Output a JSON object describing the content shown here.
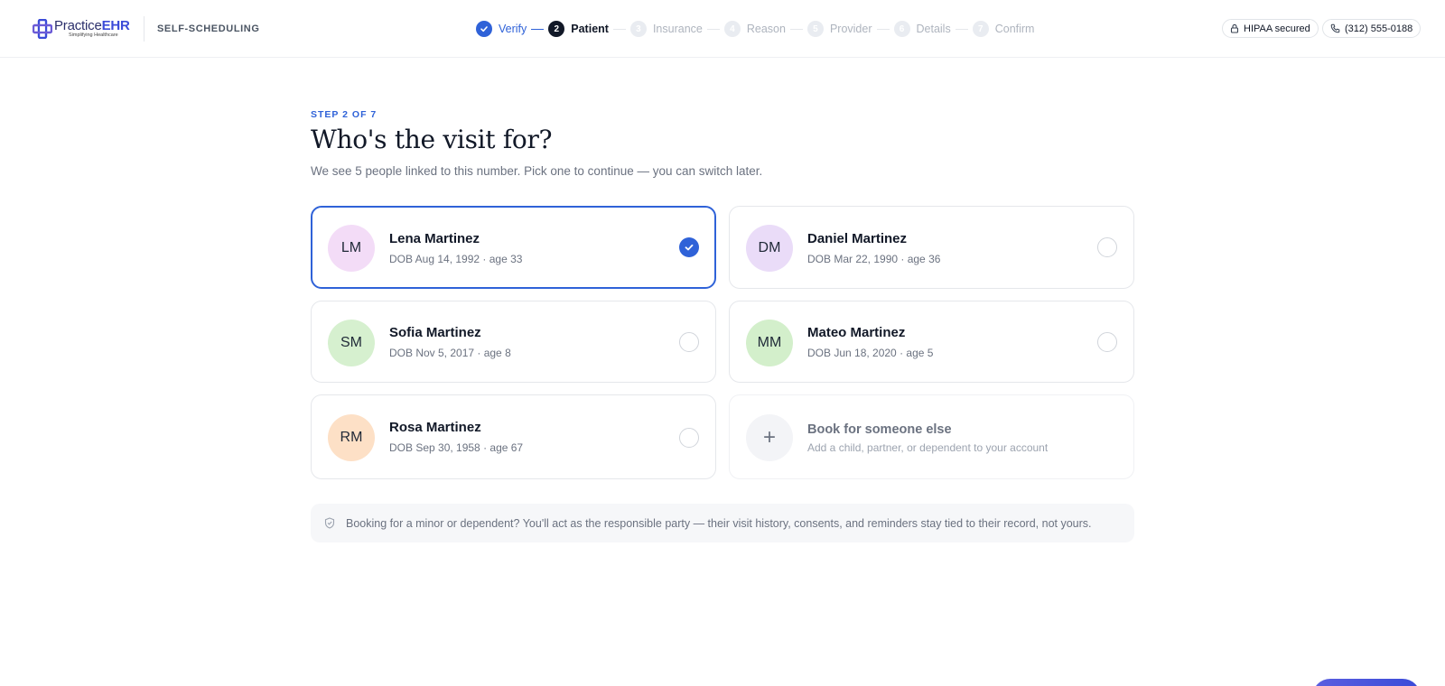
{
  "header": {
    "logo_text_a": "Practice",
    "logo_text_b": "EHR",
    "logo_tagline": "Simplifying Healthcare",
    "section_label": "SELF-SCHEDULING",
    "hipaa_label": "HIPAA secured",
    "phone_label": "(312) 555-0188"
  },
  "stepper": {
    "steps": [
      {
        "number": "1",
        "label": "Verify",
        "state": "done"
      },
      {
        "number": "2",
        "label": "Patient",
        "state": "current"
      },
      {
        "number": "3",
        "label": "Insurance",
        "state": "todo"
      },
      {
        "number": "4",
        "label": "Reason",
        "state": "todo"
      },
      {
        "number": "5",
        "label": "Provider",
        "state": "todo"
      },
      {
        "number": "6",
        "label": "Details",
        "state": "todo"
      },
      {
        "number": "7",
        "label": "Confirm",
        "state": "todo"
      }
    ]
  },
  "main": {
    "eyebrow": "STEP 2 OF 7",
    "title": "Who's the visit for?",
    "subtitle": "We see 5 people linked to this number. Pick one to continue — you can switch later."
  },
  "patients": [
    {
      "initials": "LM",
      "name": "Lena Martinez",
      "dob": "DOB Aug 14, 1992 · age 33",
      "selected": true,
      "avatar_bg": "#f3dcf7"
    },
    {
      "initials": "DM",
      "name": "Daniel Martinez",
      "dob": "DOB Mar 22, 1990 · age 36",
      "selected": false,
      "avatar_bg": "#eadcf8"
    },
    {
      "initials": "SM",
      "name": "Sofia Martinez",
      "dob": "DOB Nov 5, 2017 · age 8",
      "selected": false,
      "avatar_bg": "#d6f0cf"
    },
    {
      "initials": "MM",
      "name": "Mateo Martinez",
      "dob": "DOB Jun 18, 2020 · age 5",
      "selected": false,
      "avatar_bg": "#d3efcb"
    },
    {
      "initials": "RM",
      "name": "Rosa Martinez",
      "dob": "DOB Sep 30, 1958 · age 67",
      "selected": false,
      "avatar_bg": "#fde0c6"
    }
  ],
  "add_person": {
    "title": "Book for someone else",
    "subtitle": "Add a child, partner, or dependent to your account"
  },
  "notice": {
    "text": "Booking for a minor or dependent? You'll act as the responsible party — their visit history, consents, and reminders stay tied to their record, not yours."
  },
  "colors": {
    "accent": "#2f62d8",
    "brand": "#3b4bd8"
  }
}
